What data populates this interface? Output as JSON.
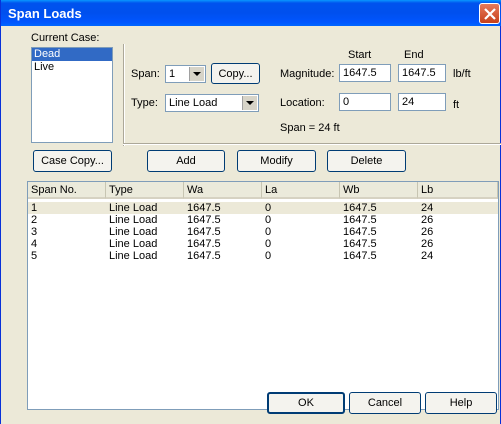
{
  "window": {
    "title": "Span Loads"
  },
  "case": {
    "label": "Current Case:",
    "items": [
      "Dead",
      "Live"
    ],
    "selected": "Dead",
    "copy_button": "Case Copy..."
  },
  "span": {
    "label": "Span:",
    "value": "1",
    "copy_button": "Copy..."
  },
  "type": {
    "label": "Type:",
    "value": "Line Load"
  },
  "magnitude": {
    "label": "Magnitude:",
    "start": "1647.5",
    "end": "1647.5",
    "unit": "lb/ft"
  },
  "location": {
    "label": "Location:",
    "start": "0",
    "end": "24",
    "unit": "ft"
  },
  "columns_header": {
    "start": "Start",
    "end": "End"
  },
  "span_info": "Span = 24 ft",
  "actions": {
    "add": "Add",
    "modify": "Modify",
    "delete": "Delete"
  },
  "table": {
    "headers": [
      "Span No.",
      "Type",
      "Wa",
      "La",
      "Wb",
      "Lb"
    ],
    "rows": [
      [
        "1",
        "Line Load",
        "1647.5",
        "0",
        "1647.5",
        "24"
      ],
      [
        "2",
        "Line Load",
        "1647.5",
        "0",
        "1647.5",
        "26"
      ],
      [
        "3",
        "Line Load",
        "1647.5",
        "0",
        "1647.5",
        "26"
      ],
      [
        "4",
        "Line Load",
        "1647.5",
        "0",
        "1647.5",
        "26"
      ],
      [
        "5",
        "Line Load",
        "1647.5",
        "0",
        "1647.5",
        "24"
      ]
    ],
    "selected_row": 0
  },
  "footer": {
    "ok": "OK",
    "cancel": "Cancel",
    "help": "Help"
  },
  "colors": {
    "title_bar": "#0054e3",
    "selection": "#316ac5",
    "dialog_bg": "#ece9d8"
  }
}
